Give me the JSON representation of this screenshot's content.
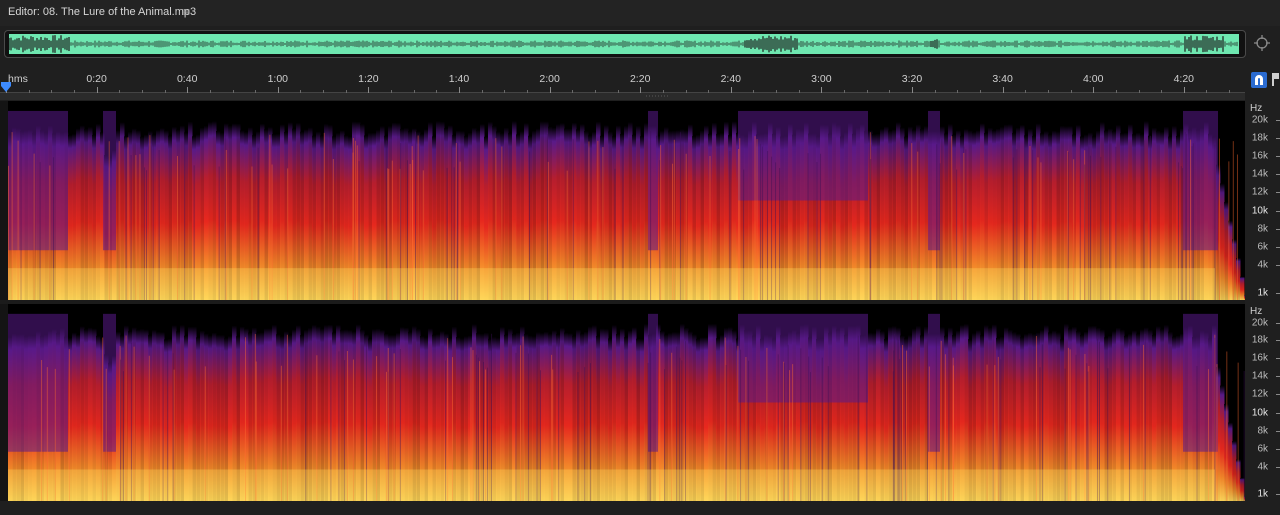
{
  "editor": {
    "title": "Editor: 08. The Lure of the Animal.mp3",
    "menu_icon": "hamburger-menu-icon"
  },
  "overview": {
    "waveform_color": "#6ee7b0",
    "zoom_icon": "zoom-navigator-icon"
  },
  "timeline": {
    "unit": "hms",
    "ticks": [
      "0:20",
      "0:40",
      "1:00",
      "1:20",
      "1:40",
      "2:00",
      "2:20",
      "2:40",
      "3:00",
      "3:20",
      "3:40",
      "4:00",
      "4:20"
    ],
    "playhead_color": "#3d8bff",
    "snap_icon": "snap-magnet-icon",
    "marker_icon": "marker-icon"
  },
  "spectral": {
    "colors": {
      "low": "#000000",
      "mid": "#5a1a8a",
      "high": "#e8281e",
      "peak": "#ffd75a"
    },
    "hz_unit": "Hz",
    "hz_labels": [
      "20k",
      "18k",
      "16k",
      "14k",
      "12k",
      "10k",
      "8k",
      "6k",
      "4k",
      "1k"
    ]
  }
}
